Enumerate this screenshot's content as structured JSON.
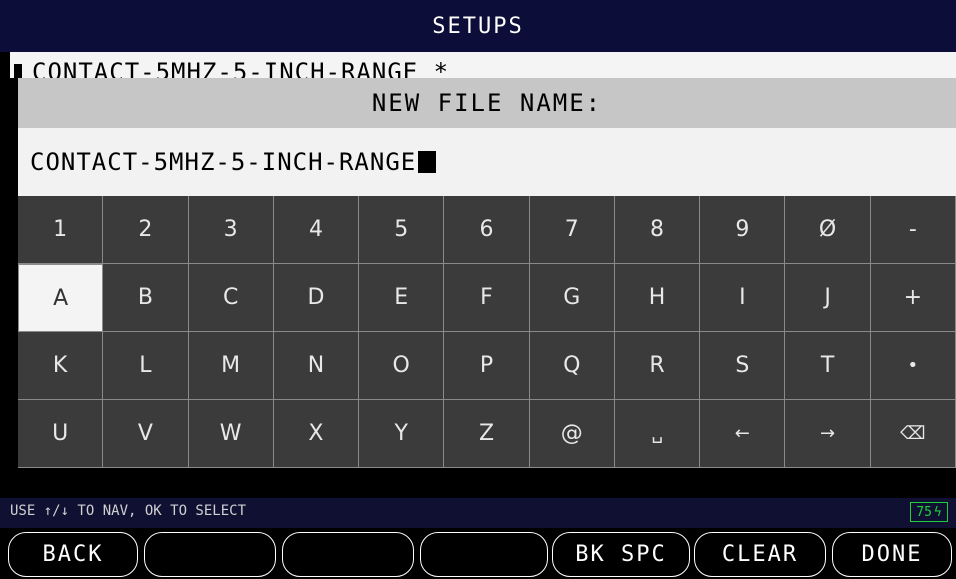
{
  "header": {
    "title": "SETUPS"
  },
  "background_list": {
    "selected_item": "CONTACT-5MHZ-5-INCH-RANGE *"
  },
  "dialog": {
    "title": "NEW FILE NAME:",
    "input_value": "CONTACT-5MHZ-5-INCH-RANGE"
  },
  "keyboard": {
    "selected_key": "A",
    "rows": [
      [
        "1",
        "2",
        "3",
        "4",
        "5",
        "6",
        "7",
        "8",
        "9",
        "Ø",
        "-"
      ],
      [
        "A",
        "B",
        "C",
        "D",
        "E",
        "F",
        "G",
        "H",
        "I",
        "J",
        "+"
      ],
      [
        "K",
        "L",
        "M",
        "N",
        "O",
        "P",
        "Q",
        "R",
        "S",
        "T",
        "•"
      ],
      [
        "U",
        "V",
        "W",
        "X",
        "Y",
        "Z",
        "@",
        "␣",
        "←",
        "→",
        "⌫"
      ]
    ],
    "key_names": [
      [
        "key-1",
        "key-2",
        "key-3",
        "key-4",
        "key-5",
        "key-6",
        "key-7",
        "key-8",
        "key-9",
        "key-0",
        "key-dash"
      ],
      [
        "key-a",
        "key-b",
        "key-c",
        "key-d",
        "key-e",
        "key-f",
        "key-g",
        "key-h",
        "key-i",
        "key-j",
        "key-plus"
      ],
      [
        "key-k",
        "key-l",
        "key-m",
        "key-n",
        "key-o",
        "key-p",
        "key-q",
        "key-r",
        "key-s",
        "key-t",
        "key-period"
      ],
      [
        "key-u",
        "key-v",
        "key-w",
        "key-x",
        "key-y",
        "key-z",
        "key-at",
        "space-key",
        "left-arrow-key",
        "right-arrow-key",
        "backspace-icon-key"
      ]
    ]
  },
  "status": {
    "hint": "USE ↑/↓ TO NAV, OK TO SELECT",
    "battery": "75",
    "battery_color": "#1fcf3a"
  },
  "softkeys": [
    "BACK",
    "",
    "",
    "",
    "BK SPC",
    "CLEAR",
    "DONE"
  ]
}
